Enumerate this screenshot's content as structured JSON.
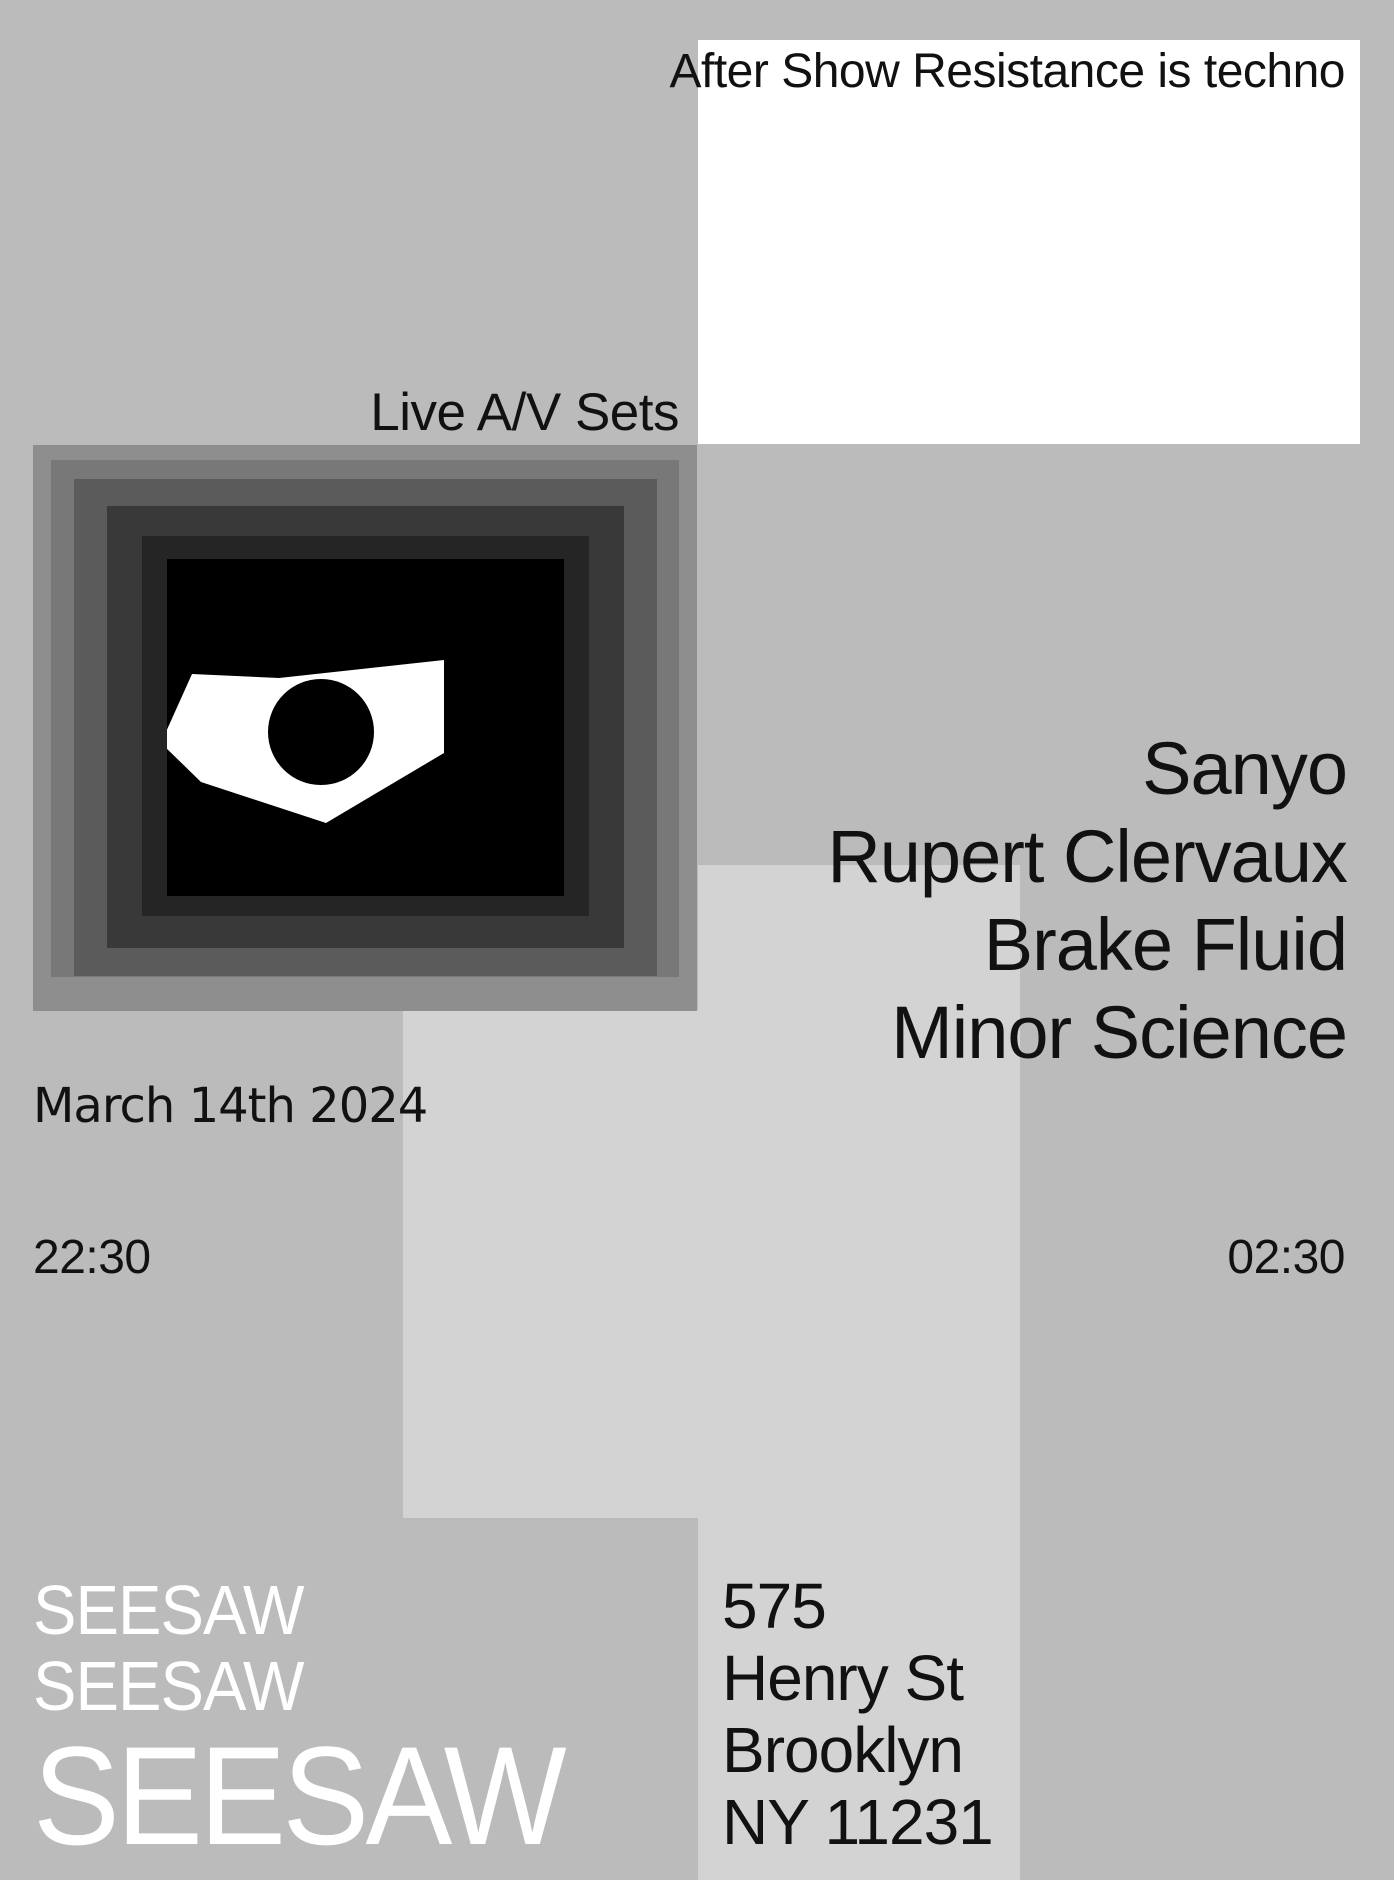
{
  "poster": {
    "event_title": "After Show Resistance is techno",
    "sets_label": "Live A/V Sets",
    "lineup": [
      "Sanyo",
      "Rupert Clervaux",
      "Brake Fluid",
      "Minor Science"
    ],
    "date": "March 14th 2024",
    "start_time": "22:30",
    "end_time": "02:30",
    "venue_logo": [
      "SEESAW",
      "SEESAW",
      "SEESAW"
    ],
    "address": [
      "575",
      "Henry St",
      "Brooklyn",
      "NY 11231"
    ]
  },
  "colors": {
    "background": "#bbbbbb",
    "white_block": "#ffffff",
    "light_block": "#d3d3d3",
    "frame_shades": [
      "#8e8e8e",
      "#787878",
      "#5b5b5b",
      "#393939",
      "#252525",
      "#000000"
    ],
    "text": "#111111",
    "logo_text": "#ffffff"
  },
  "artwork": {
    "subject": "eye-icon"
  }
}
